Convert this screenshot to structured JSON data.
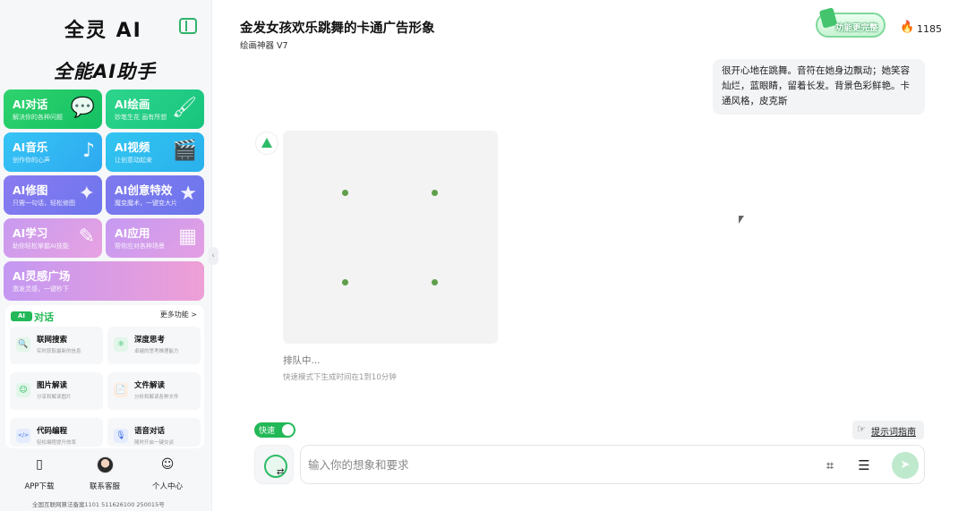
{
  "sidebar": {
    "brand": "全灵 AI",
    "slogan": "全能AI助手",
    "cards": [
      {
        "title": "AI对话",
        "sub": "解决你的各种问题",
        "icon": "💬"
      },
      {
        "title": "AI绘画",
        "sub": "妙笔生花 画有所想",
        "icon": "🖌"
      },
      {
        "title": "AI音乐",
        "sub": "创作你的心声",
        "icon": "♪"
      },
      {
        "title": "AI视频",
        "sub": "让创意动起来",
        "icon": "🎬"
      },
      {
        "title": "AI修图",
        "sub": "只需一句话，轻松修图",
        "icon": "✦"
      },
      {
        "title": "AI创意特效",
        "sub": "魔变魔术，一键变大片",
        "icon": "★"
      },
      {
        "title": "AI学习",
        "sub": "助你轻松掌握AI技能",
        "icon": "✎"
      },
      {
        "title": "AI应用",
        "sub": "帮你应对各种场景",
        "icon": "▦"
      },
      {
        "title": "AI灵感广场",
        "sub": "激发灵感，一键秒下",
        "icon": ""
      }
    ],
    "chat_section": {
      "badge": "AI",
      "title": "对话",
      "more": "更多功能 >",
      "features": [
        {
          "title": "联网搜索",
          "sub": "实时获取最新的信息",
          "icon": "🔍"
        },
        {
          "title": "深度思考",
          "sub": "卓越的思考推理能力",
          "icon": "⚛"
        },
        {
          "title": "图片解读",
          "sub": "分享和解读图片",
          "icon": "☺"
        },
        {
          "title": "文件解读",
          "sub": "分析和解读各种文件",
          "icon": "📄"
        },
        {
          "title": "代码编程",
          "sub": "轻松编程提升效率",
          "icon": "</>"
        },
        {
          "title": "语音对话",
          "sub": "随时开启一键交谈",
          "icon": "🎙"
        }
      ]
    },
    "bottom_nav": [
      {
        "label": "APP下载",
        "icon": "phone-icon"
      },
      {
        "label": "联系客服",
        "icon": "avatar"
      },
      {
        "label": "个人中心",
        "icon": "user-icon"
      }
    ],
    "icp": "全国互联网算法备案1101 511626100 250015号"
  },
  "header": {
    "title": "金发女孩欢乐跳舞的卡通广告形象",
    "subtitle": "绘画神器 V7",
    "vip_label": "功能更完整",
    "credits": "1185"
  },
  "conversation": {
    "user_message": "很开心地在跳舞。音符在她身边飘动；她笑容灿烂，蓝眼睛，留着长发。背景色彩鲜艳。卡通风格，皮克斯",
    "status": "排队中...",
    "hint": "快速模式下生成时间在1到10分钟"
  },
  "composer": {
    "fast_label": "快速",
    "fast_on": true,
    "prompt_guide": "提示词指南",
    "placeholder": "输入你的想象和要求"
  },
  "colors": {
    "accent": "#22b857"
  }
}
